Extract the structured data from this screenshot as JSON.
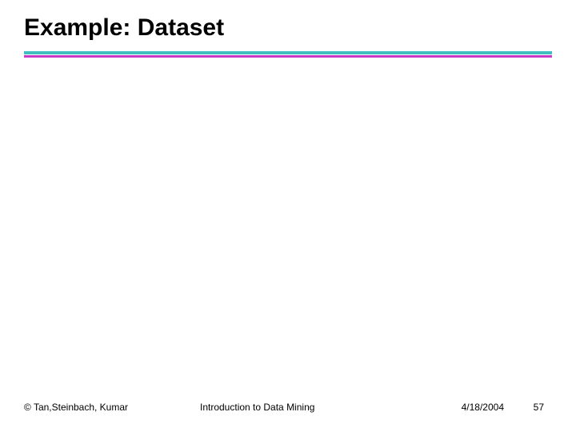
{
  "slide": {
    "title": "Example: Dataset"
  },
  "footer": {
    "copyright": "© Tan,Steinbach, Kumar",
    "course": "Introduction to Data Mining",
    "date": "4/18/2004",
    "page": "57"
  }
}
